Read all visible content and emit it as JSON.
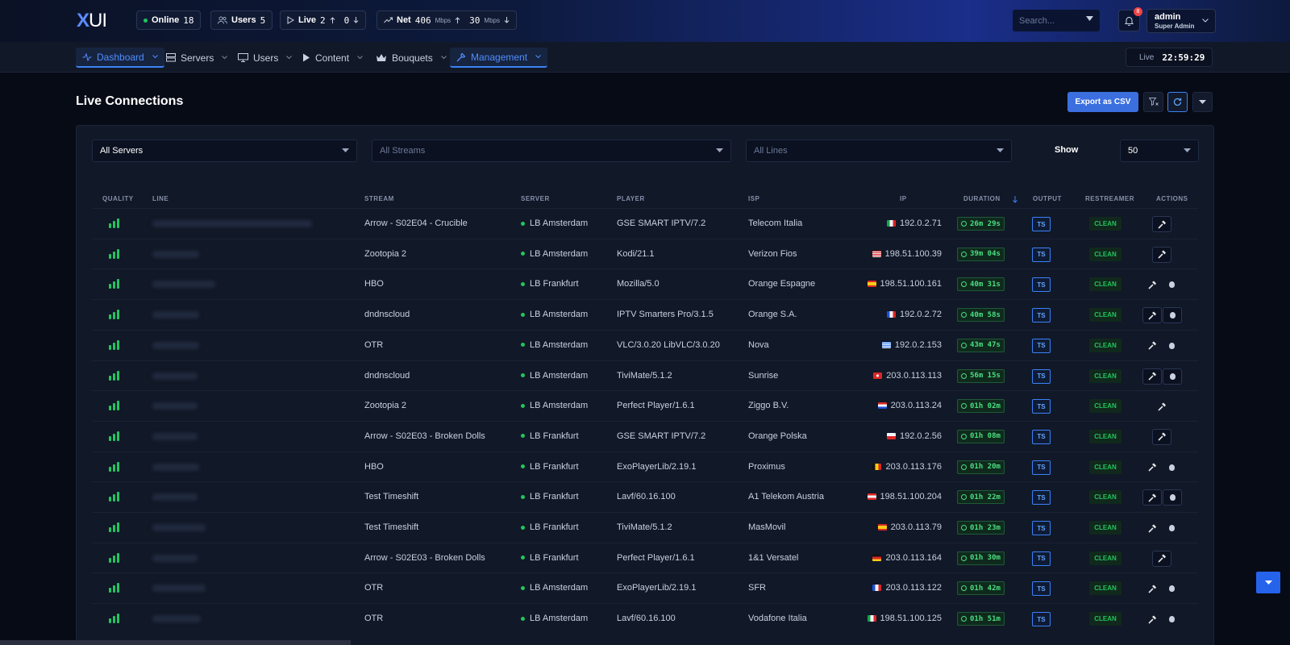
{
  "header": {
    "logo_x": "X",
    "logo_ui": "UI",
    "stats": {
      "online_label": "Online",
      "online_value": "18",
      "users_label": "Users",
      "users_value": "5",
      "live_label": "Live",
      "live_up": "2",
      "live_down": "0",
      "net_label": "Net",
      "net_in": "406",
      "net_out": "30",
      "net_unit": "Mbps"
    },
    "search_placeholder": "Search...",
    "notifications_count": "8",
    "user_name": "admin",
    "user_role": "Super Admin"
  },
  "nav": {
    "items": [
      {
        "label": "Dashboard",
        "icon": "activity-icon"
      },
      {
        "label": "Servers",
        "icon": "server-icon"
      },
      {
        "label": "Users",
        "icon": "monitor-icon"
      },
      {
        "label": "Content",
        "icon": "play-icon"
      },
      {
        "label": "Bouquets",
        "icon": "bouquet-icon"
      },
      {
        "label": "Management",
        "icon": "wrench-icon"
      }
    ],
    "live_label": "Live",
    "clock": "22:59:29"
  },
  "page": {
    "title": "Live Connections",
    "export_label": "Export as CSV"
  },
  "filters": {
    "servers": "All Servers",
    "streams": "All Streams",
    "lines": "All Lines",
    "show_label": "Show",
    "show_value": "50"
  },
  "table": {
    "columns": {
      "quality": "QUALITY",
      "line": "LINE",
      "stream": "STREAM",
      "server": "SERVER",
      "player": "PLAYER",
      "isp": "ISP",
      "ip": "IP",
      "duration": "DURATION",
      "output": "OUTPUT",
      "restreamer": "RESTREAMER",
      "actions": "ACTIONS"
    },
    "rows": [
      {
        "stream": "Arrow - S02E04 - Crucible",
        "server": "LB Amsterdam",
        "player": "GSE SMART IPTV/7.2",
        "isp": "Telecom Italia",
        "ip": "192.0.2.71",
        "duration": "26m 29s",
        "output": "TS",
        "restreamer": "CLEAN",
        "flag": "it"
      },
      {
        "stream": "Zootopia 2",
        "server": "LB Amsterdam",
        "player": "Kodi/21.1",
        "isp": "Verizon Fios",
        "ip": "198.51.100.39",
        "duration": "39m 04s",
        "output": "TS",
        "restreamer": "CLEAN",
        "flag": "us"
      },
      {
        "stream": "HBO",
        "server": "LB Frankfurt",
        "player": "Mozilla/5.0",
        "isp": "Orange Espagne",
        "ip": "198.51.100.161",
        "duration": "40m 31s",
        "output": "TS",
        "restreamer": "CLEAN",
        "flag": "es"
      },
      {
        "stream": "dndnscloud",
        "server": "LB Amsterdam",
        "player": "IPTV Smarters Pro/3.1.5",
        "isp": "Orange S.A.",
        "ip": "192.0.2.72",
        "duration": "40m 58s",
        "output": "TS",
        "restreamer": "CLEAN",
        "flag": "fr"
      },
      {
        "stream": "OTR",
        "server": "LB Amsterdam",
        "player": "VLC/3.0.20 LibVLC/3.0.20",
        "isp": "Nova",
        "ip": "192.0.2.153",
        "duration": "43m 47s",
        "output": "TS",
        "restreamer": "CLEAN",
        "flag": "gr"
      },
      {
        "stream": "dndnscloud",
        "server": "LB Amsterdam",
        "player": "TiviMate/5.1.2",
        "isp": "Sunrise",
        "ip": "203.0.113.113",
        "duration": "56m 15s",
        "output": "TS",
        "restreamer": "CLEAN",
        "flag": "ch"
      },
      {
        "stream": "Zootopia 2",
        "server": "LB Amsterdam",
        "player": "Perfect Player/1.6.1",
        "isp": "Ziggo B.V.",
        "ip": "203.0.113.24",
        "duration": "01h 02m",
        "output": "TS",
        "restreamer": "CLEAN",
        "flag": "nl"
      },
      {
        "stream": "Arrow - S02E03 - Broken Dolls",
        "server": "LB Frankfurt",
        "player": "GSE SMART IPTV/7.2",
        "isp": "Orange Polska",
        "ip": "192.0.2.56",
        "duration": "01h 08m",
        "output": "TS",
        "restreamer": "CLEAN",
        "flag": "pl"
      },
      {
        "stream": "HBO",
        "server": "LB Frankfurt",
        "player": "ExoPlayerLib/2.19.1",
        "isp": "Proximus",
        "ip": "203.0.113.176",
        "duration": "01h 20m",
        "output": "TS",
        "restreamer": "CLEAN",
        "flag": "be"
      },
      {
        "stream": "Test Timeshift",
        "server": "LB Frankfurt",
        "player": "Lavf/60.16.100",
        "isp": "A1 Telekom Austria",
        "ip": "198.51.100.204",
        "duration": "01h 22m",
        "output": "TS",
        "restreamer": "CLEAN",
        "flag": "at"
      },
      {
        "stream": "Test Timeshift",
        "server": "LB Frankfurt",
        "player": "TiviMate/5.1.2",
        "isp": "MasMovil",
        "ip": "203.0.113.79",
        "duration": "01h 23m",
        "output": "TS",
        "restreamer": "CLEAN",
        "flag": "es"
      },
      {
        "stream": "Arrow - S02E03 - Broken Dolls",
        "server": "LB Frankfurt",
        "player": "Perfect Player/1.6.1",
        "isp": "1&1 Versatel",
        "ip": "203.0.113.164",
        "duration": "01h 30m",
        "output": "TS",
        "restreamer": "CLEAN",
        "flag": "de"
      },
      {
        "stream": "OTR",
        "server": "LB Amsterdam",
        "player": "ExoPlayerLib/2.19.1",
        "isp": "SFR",
        "ip": "203.0.113.122",
        "duration": "01h 42m",
        "output": "TS",
        "restreamer": "CLEAN",
        "flag": "fr"
      },
      {
        "stream": "OTR",
        "server": "LB Amsterdam",
        "player": "Lavf/60.16.100",
        "isp": "Vodafone Italia",
        "ip": "198.51.100.125",
        "duration": "01h 51m",
        "output": "TS",
        "restreamer": "CLEAN",
        "flag": "it"
      }
    ]
  }
}
